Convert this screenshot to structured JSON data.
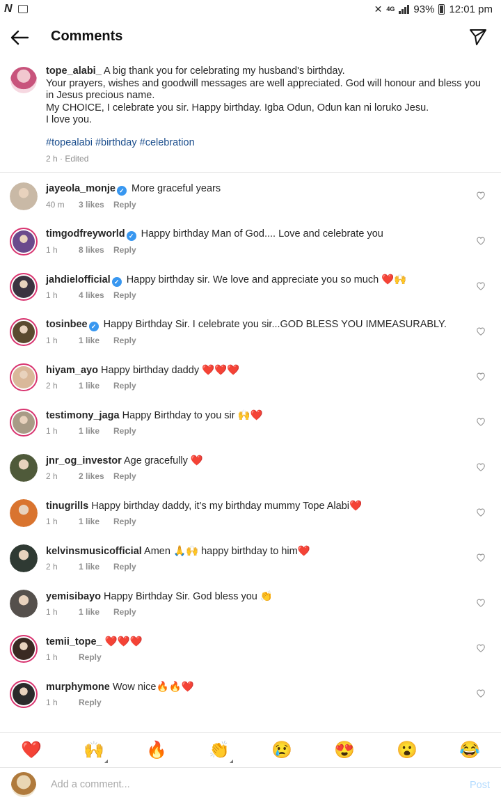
{
  "status_bar": {
    "left_text": "N",
    "network": "4G",
    "battery": "93%",
    "time": "12:01 pm"
  },
  "header": {
    "title": "Comments"
  },
  "caption": {
    "username": "tope_alabi_",
    "text": " A big thank you for celebrating my husband's birthday.\nYour prayers, wishes and goodwill messages are well appreciated. God will honour and bless you in Jesus precious name.\nMy CHOICE, I celebrate you sir. Happy birthday. Igba Odun, Odun kan ni loruko Jesu.\nI love you.",
    "hashtags": "#topealabi #birthday #celebration",
    "meta": "2 h · Edited"
  },
  "comments": [
    {
      "username": "jayeola_monje",
      "verified": true,
      "text": "More graceful years",
      "time": "40 m",
      "likes": "3 likes",
      "reply": "Reply",
      "ring": false,
      "color": "#c9b9a6"
    },
    {
      "username": "timgodfreyworld",
      "verified": true,
      "text": "Happy birthday Man of God.... Love and celebrate you",
      "time": "1 h",
      "likes": "8 likes",
      "reply": "Reply",
      "ring": true,
      "color": "#6a4a8c"
    },
    {
      "username": "jahdielofficial",
      "verified": true,
      "text": "Happy birthday sir. We love and appreciate you so much ❤️🙌",
      "time": "1 h",
      "likes": "4 likes",
      "reply": "Reply",
      "ring": true,
      "color": "#3b3340"
    },
    {
      "username": "tosinbee",
      "verified": true,
      "text": "Happy Birthday Sir. I celebrate you sir...GOD BLESS YOU IMMEASURABLY.",
      "time": "1 h",
      "likes": "1 like",
      "reply": "Reply",
      "ring": true,
      "color": "#5a4a2f"
    },
    {
      "username": "hiyam_ayo",
      "verified": false,
      "text": "Happy birthday daddy ❤️❤️❤️",
      "time": "2 h",
      "likes": "1 like",
      "reply": "Reply",
      "ring": true,
      "color": "#d9b89a"
    },
    {
      "username": "testimony_jaga",
      "verified": false,
      "text": "Happy Birthday to you sir 🙌❤️",
      "time": "1 h",
      "likes": "1 like",
      "reply": "Reply",
      "ring": true,
      "color": "#a89b86"
    },
    {
      "username": "jnr_og_investor",
      "verified": false,
      "text": "Age gracefully ❤️",
      "time": "2 h",
      "likes": "2 likes",
      "reply": "Reply",
      "ring": false,
      "color": "#4f5a3a"
    },
    {
      "username": "tinugrills",
      "verified": false,
      "text": "Happy birthday daddy, it’s my birthday mummy Tope Alabi❤️",
      "time": "1 h",
      "likes": "1 like",
      "reply": "Reply",
      "ring": false,
      "color": "#d9742f"
    },
    {
      "username": "kelvinsmusicofficial",
      "verified": false,
      "text": "Amen 🙏🙌 happy birthday to him❤️",
      "time": "2 h",
      "likes": "1 like",
      "reply": "Reply",
      "ring": false,
      "color": "#2f3a33"
    },
    {
      "username": "yemisibayo",
      "verified": false,
      "text": "Happy Birthday Sir. God bless you 👏",
      "time": "1 h",
      "likes": "1 like",
      "reply": "Reply",
      "ring": false,
      "color": "#55504c"
    },
    {
      "username": "temii_tope_",
      "verified": false,
      "text": "❤️❤️❤️",
      "time": "1 h",
      "likes": "",
      "reply": "Reply",
      "ring": true,
      "color": "#3a2a22"
    },
    {
      "username": "murphymone",
      "verified": false,
      "text": "Wow nice🔥🔥❤️",
      "time": "1 h",
      "likes": "",
      "reply": "Reply",
      "ring": true,
      "color": "#2b2b2b"
    }
  ],
  "emoji_bar": [
    "❤️",
    "🙌",
    "🔥",
    "👏",
    "😢",
    "😍",
    "😮",
    "😂"
  ],
  "input": {
    "placeholder": "Add a comment...",
    "post_label": "Post"
  },
  "colors": {
    "accent_blue": "#3897f0",
    "hashtag": "#1a4d8c",
    "post_disabled": "#b3dbff",
    "story_ring": "#d8336f"
  }
}
